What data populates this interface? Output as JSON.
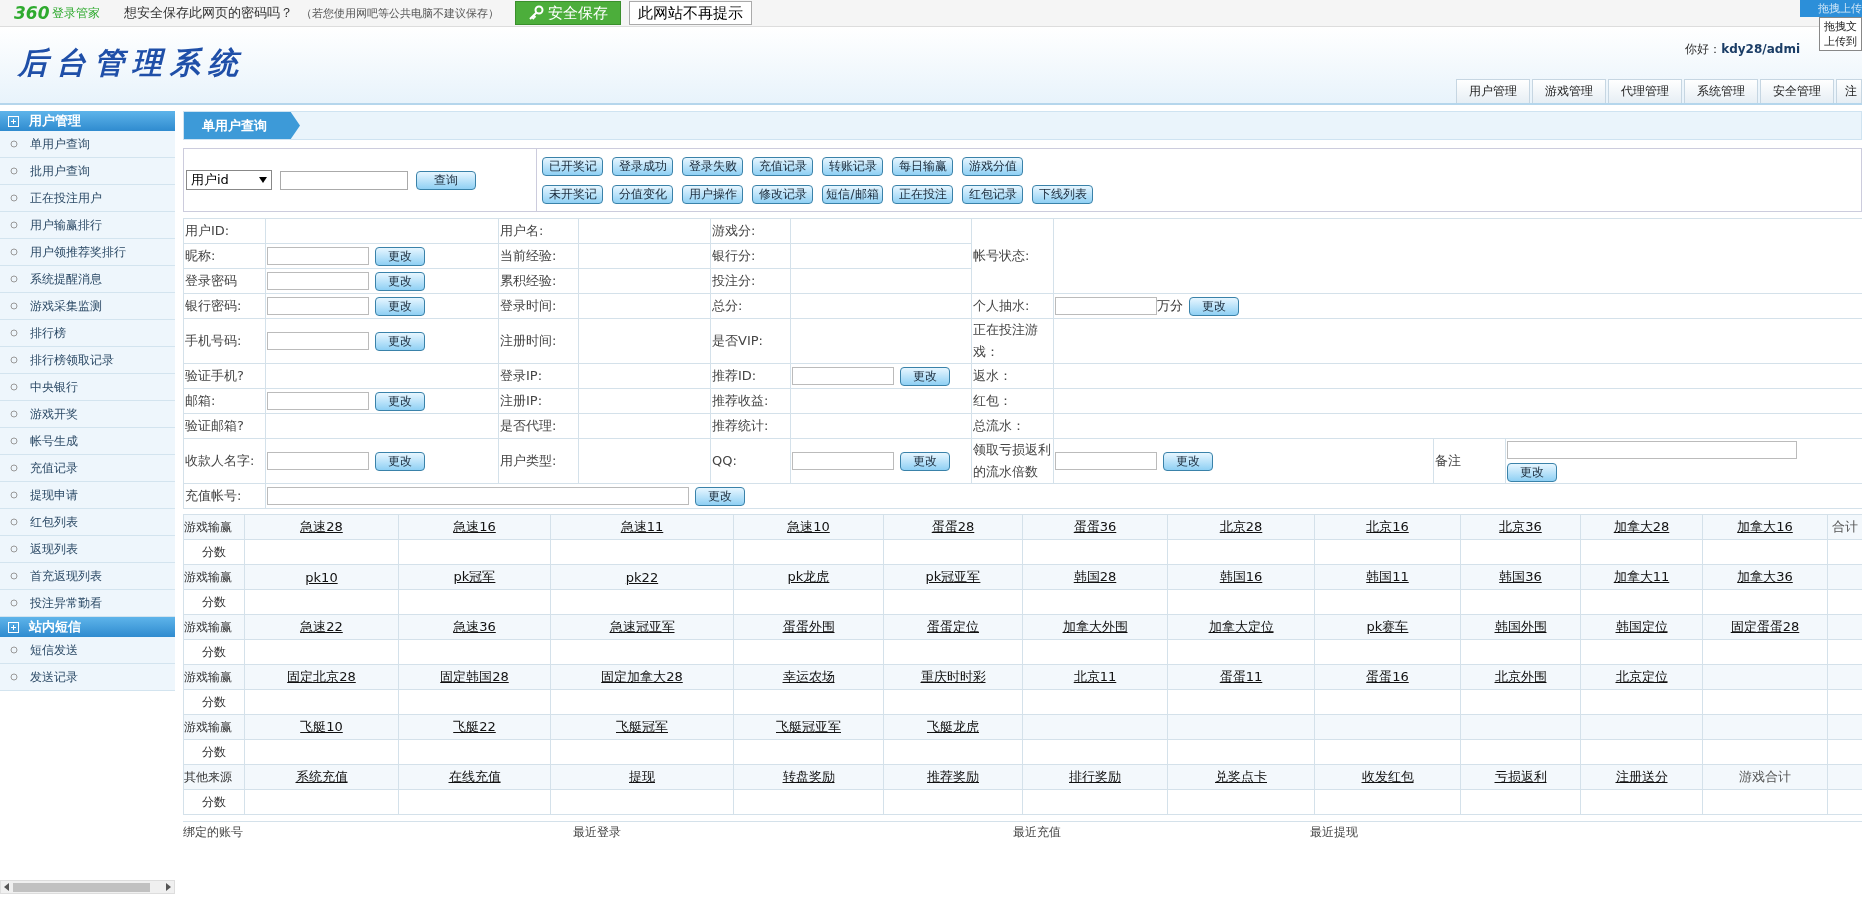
{
  "browser_bar": {
    "brand": "360",
    "brand_name": "登录管家",
    "question": "想安全保存此网页的密码吗？",
    "note": "（若您使用网吧等公共电脑不建议保存）",
    "save_button": "安全保存",
    "dismiss_button": "此网站不再提示",
    "upload_button": "拖拽上传",
    "upload_tooltip": [
      "拖拽文",
      "上传到"
    ]
  },
  "header": {
    "title": "后台管理系统",
    "greeting": "你好：",
    "user": "kdy28/admi",
    "nav": [
      "用户管理",
      "游戏管理",
      "代理管理",
      "系统管理",
      "安全管理",
      "注"
    ]
  },
  "sidebar": {
    "sections": [
      {
        "title": "用户管理",
        "items": [
          "单用户查询",
          "批用户查询",
          "正在投注用户",
          "用户输赢排行",
          "用户领推荐奖排行",
          "系统提醒消息",
          "游戏采集监测",
          "排行榜",
          "排行榜领取记录",
          "中央银行",
          "游戏开奖",
          "帐号生成",
          "充值记录",
          "提现申请",
          "红包列表",
          "返现列表",
          "首充返现列表",
          "投注异常勤看"
        ]
      },
      {
        "title": "站内短信",
        "items": [
          "短信发送",
          "发送记录"
        ]
      }
    ]
  },
  "panel": {
    "title": "单用户查询",
    "query": {
      "select": "用户id",
      "button": "查询"
    },
    "record_buttons": [
      [
        "已开奖记",
        "登录成功",
        "登录失败",
        "充值记录",
        "转账记录",
        "每日输赢",
        "游戏分值"
      ],
      [
        "未开奖记",
        "分值变化",
        "用户操作",
        "修改记录",
        "短信/邮箱",
        "正在投注",
        "红包记录",
        "下线列表"
      ]
    ],
    "info_rows": [
      {
        "cells": [
          {
            "label": "用户ID:",
            "kind": "plain"
          },
          {
            "label": "用户名:",
            "kind": "plain"
          },
          {
            "label": "游戏分:",
            "kind": "plain"
          },
          {
            "label": "帐号状态:",
            "kind": "plain",
            "merged_down": true
          }
        ]
      },
      {
        "cells": [
          {
            "label": "昵称:",
            "kind": "edit",
            "button": "更改"
          },
          {
            "label": "当前经验:",
            "kind": "plain"
          },
          {
            "label": "银行分:",
            "kind": "plain"
          }
        ]
      },
      {
        "cells": [
          {
            "label": "登录密码",
            "kind": "edit",
            "button": "更改"
          },
          {
            "label": "累积经验:",
            "kind": "plain"
          },
          {
            "label": "投注分:",
            "kind": "plain"
          }
        ]
      },
      {
        "cells": [
          {
            "label": "银行密码:",
            "kind": "edit",
            "button": "更改"
          },
          {
            "label": "登录时间:",
            "kind": "plain"
          },
          {
            "label": "总分:",
            "kind": "plain"
          },
          {
            "label": "个人抽水:",
            "kind": "edit",
            "unit": "万分",
            "button": "更改"
          }
        ]
      },
      {
        "cells": [
          {
            "label": "手机号码:",
            "kind": "edit",
            "button": "更改"
          },
          {
            "label": "注册时间:",
            "kind": "plain"
          },
          {
            "label": "是否VIP:",
            "kind": "plain"
          },
          {
            "label": "正在投注游戏：",
            "kind": "plain"
          }
        ]
      },
      {
        "cells": [
          {
            "label": "验证手机?",
            "kind": "plain"
          },
          {
            "label": "登录IP:",
            "kind": "plain"
          },
          {
            "label": "推荐ID:",
            "kind": "edit",
            "button": "更改"
          },
          {
            "label": "返水：",
            "kind": "plain"
          }
        ]
      },
      {
        "cells": [
          {
            "label": "邮箱:",
            "kind": "edit",
            "button": "更改"
          },
          {
            "label": "注册IP:",
            "kind": "plain"
          },
          {
            "label": "推荐收益:",
            "kind": "plain"
          },
          {
            "label": "红包：",
            "kind": "plain"
          }
        ]
      },
      {
        "cells": [
          {
            "label": "验证邮箱?",
            "kind": "plain"
          },
          {
            "label": "是否代理:",
            "kind": "plain"
          },
          {
            "label": "推荐统计:",
            "kind": "plain"
          },
          {
            "label": "总流水：",
            "kind": "plain"
          }
        ]
      },
      {
        "cells": [
          {
            "label": "收款人名字:",
            "kind": "edit",
            "button": "更改"
          },
          {
            "label": "用户类型:",
            "kind": "plain"
          },
          {
            "label": "QQ:",
            "kind": "edit",
            "button": "更改"
          },
          {
            "label": "领取亏损返利的流水倍数",
            "kind": "edit",
            "button": "更改"
          },
          {
            "label": "备注",
            "kind": "edit_stacked",
            "button": "更改"
          }
        ]
      },
      {
        "cells": [
          {
            "label": "充值帐号:",
            "kind": "edit_wide",
            "button": "更改"
          }
        ]
      }
    ],
    "game_groups": [
      {
        "label": "游戏输赢",
        "score_label": "分数",
        "items": [
          {
            "text": "急速28",
            "kind": "link"
          },
          {
            "text": "急速16",
            "kind": "link"
          },
          {
            "text": "急速11",
            "kind": "link"
          },
          {
            "text": "急速10",
            "kind": "link"
          },
          {
            "text": "蛋蛋28",
            "kind": "link"
          },
          {
            "text": "蛋蛋36",
            "kind": "link"
          },
          {
            "text": "北京28",
            "kind": "link"
          },
          {
            "text": "北京16",
            "kind": "link"
          },
          {
            "text": "北京36",
            "kind": "link"
          },
          {
            "text": "加拿大28",
            "kind": "link"
          },
          {
            "text": "加拿大16",
            "kind": "link"
          },
          {
            "text": "合计",
            "kind": "plain"
          }
        ]
      },
      {
        "label": "游戏输赢",
        "score_label": "分数",
        "items": [
          {
            "text": "pk10",
            "kind": "link"
          },
          {
            "text": "pk冠军",
            "kind": "link"
          },
          {
            "text": "pk22",
            "kind": "link"
          },
          {
            "text": "pk龙虎",
            "kind": "link"
          },
          {
            "text": "pk冠亚军",
            "kind": "link"
          },
          {
            "text": "韩国28",
            "kind": "link"
          },
          {
            "text": "韩国16",
            "kind": "link"
          },
          {
            "text": "韩国11",
            "kind": "link"
          },
          {
            "text": "韩国36",
            "kind": "link"
          },
          {
            "text": "加拿大11",
            "kind": "link"
          },
          {
            "text": "加拿大36",
            "kind": "link"
          }
        ]
      },
      {
        "label": "游戏输赢",
        "score_label": "分数",
        "items": [
          {
            "text": "急速22",
            "kind": "link"
          },
          {
            "text": "急速36",
            "kind": "link"
          },
          {
            "text": "急速冠亚军",
            "kind": "link"
          },
          {
            "text": "蛋蛋外围",
            "kind": "link"
          },
          {
            "text": "蛋蛋定位",
            "kind": "link"
          },
          {
            "text": "加拿大外围",
            "kind": "link"
          },
          {
            "text": "加拿大定位",
            "kind": "link"
          },
          {
            "text": "pk赛车",
            "kind": "link"
          },
          {
            "text": "韩国外围",
            "kind": "link"
          },
          {
            "text": "韩国定位",
            "kind": "link"
          },
          {
            "text": "固定蛋蛋28",
            "kind": "link"
          }
        ]
      },
      {
        "label": "游戏输赢",
        "score_label": "分数",
        "items": [
          {
            "text": "固定北京28",
            "kind": "link"
          },
          {
            "text": "固定韩国28",
            "kind": "link"
          },
          {
            "text": "固定加拿大28",
            "kind": "link"
          },
          {
            "text": "幸运农场",
            "kind": "link"
          },
          {
            "text": "重庆时时彩",
            "kind": "link"
          },
          {
            "text": "北京11",
            "kind": "link"
          },
          {
            "text": "蛋蛋11",
            "kind": "link"
          },
          {
            "text": "蛋蛋16",
            "kind": "link"
          },
          {
            "text": "北京外围",
            "kind": "link"
          },
          {
            "text": "北京定位",
            "kind": "link"
          }
        ]
      },
      {
        "label": "游戏输赢",
        "score_label": "分数",
        "items": [
          {
            "text": "飞艇10",
            "kind": "link"
          },
          {
            "text": "飞艇22",
            "kind": "link"
          },
          {
            "text": "飞艇冠军",
            "kind": "link"
          },
          {
            "text": "飞艇冠亚军",
            "kind": "link"
          },
          {
            "text": "飞艇龙虎",
            "kind": "link"
          }
        ]
      },
      {
        "label": "其他来源",
        "score_label": "分数",
        "items": [
          {
            "text": "系统充值",
            "kind": "link"
          },
          {
            "text": "在线充值",
            "kind": "link"
          },
          {
            "text": "提现",
            "kind": "link"
          },
          {
            "text": "转盘奖励",
            "kind": "link"
          },
          {
            "text": "推荐奖励",
            "kind": "link"
          },
          {
            "text": "排行奖励",
            "kind": "link"
          },
          {
            "text": "兑奖点卡",
            "kind": "link"
          },
          {
            "text": "收发红包",
            "kind": "link"
          },
          {
            "text": "亏损返利",
            "kind": "link"
          },
          {
            "text": "注册送分",
            "kind": "link"
          },
          {
            "text": "游戏合计",
            "kind": "plain"
          }
        ]
      }
    ],
    "recent": [
      "绑定的账号",
      "最近登录",
      "最近充值",
      "最近提现"
    ]
  }
}
